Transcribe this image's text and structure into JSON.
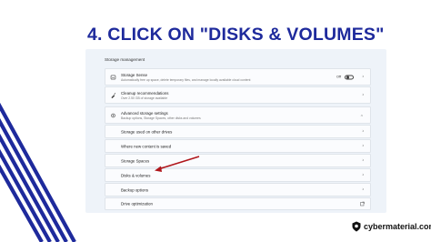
{
  "heading": "4. CLICK ON \"DISKS & VOLUMES\"",
  "colors": {
    "accent": "#1e2a9c",
    "arrow": "#b0161b",
    "panel": "#eef3f9"
  },
  "settings": {
    "section_title": "Storage management",
    "storage_sense": {
      "title": "Storage Sense",
      "description": "Automatically free up space, delete temporary files, and manage locally available cloud content",
      "toggle_label": "Off",
      "toggle_on": false,
      "icon": "storage-sense-icon"
    },
    "cleanup": {
      "title": "Cleanup recommendations",
      "description": "Over 2.50 GB of storage available",
      "icon": "cleanup-icon"
    },
    "advanced": {
      "title": "Advanced storage settings",
      "description": "Backup options, Storage Spaces, other disks and volumes",
      "icon": "gear-storage-icon",
      "expanded": true
    },
    "sub_items": [
      {
        "label": "Storage used on other drives"
      },
      {
        "label": "Where new content is saved"
      },
      {
        "label": "Storage Spaces"
      },
      {
        "label": "Disks & volumes"
      },
      {
        "label": "Backup options"
      },
      {
        "label": "Drive optimization"
      }
    ]
  },
  "brand": {
    "name": "cybermaterial.com",
    "icon": "shield-logo-icon"
  }
}
